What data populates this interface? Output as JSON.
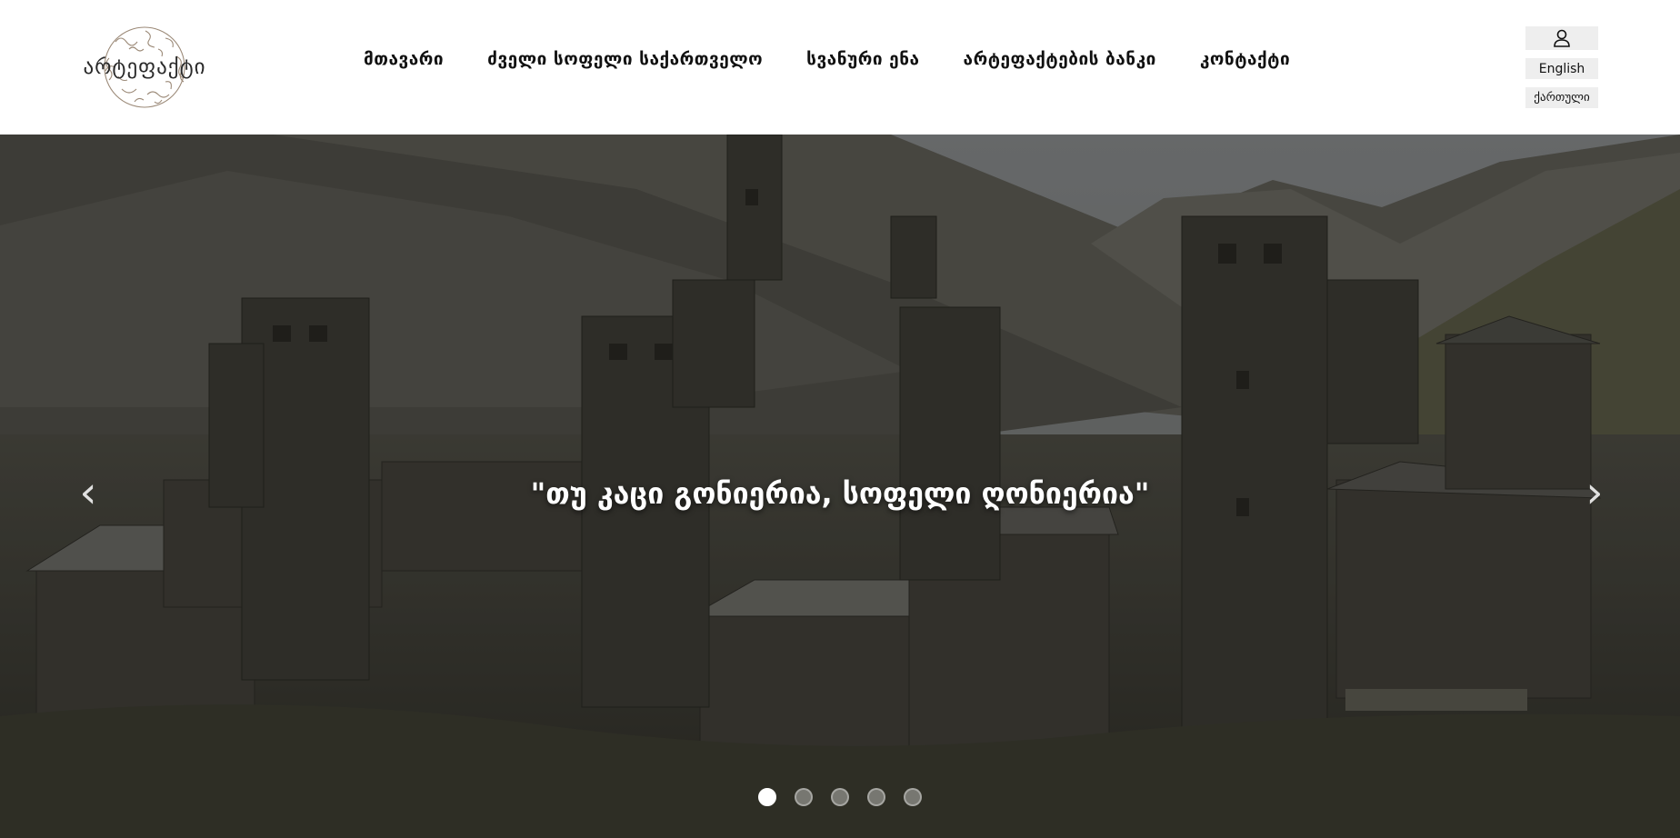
{
  "header": {
    "logo_text": "არტეფაქტი",
    "logo_icon": "doodle-circle-logo"
  },
  "nav": {
    "items": [
      {
        "label": "მთავარი"
      },
      {
        "label": "ძველი სოფელი საქართველო"
      },
      {
        "label": "სვანური ენა"
      },
      {
        "label": "არტეფაქტების ბანკი"
      },
      {
        "label": "კონტაქტი"
      }
    ]
  },
  "account": {
    "icon": "user-icon",
    "lang_en": "English",
    "lang_ka": "ქართული"
  },
  "hero": {
    "caption": "\"თუ კაცი გონიერია, სოფელი ღონიერია\"",
    "prev_icon": "‹",
    "next_icon": "›",
    "slide_count": 5,
    "active_slide": 1
  },
  "colors": {
    "header_bg": "#ffffff",
    "lang_button_bg": "#eeeeee",
    "caption_text": "#ffffff"
  }
}
